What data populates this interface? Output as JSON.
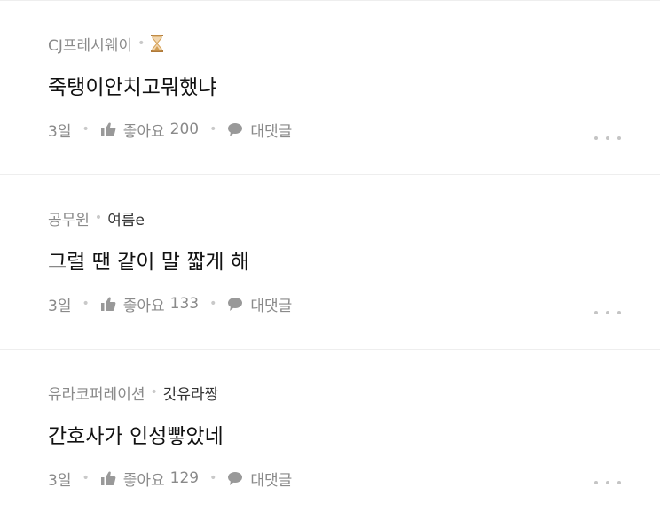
{
  "comments": [
    {
      "company": "CJ프레시웨이",
      "nickname": "",
      "has_hourglass": true,
      "text": "죽탱이안치고뭐했냐",
      "time": "3일",
      "like_label": "좋아요",
      "like_count": "200",
      "reply_label": "대댓글"
    },
    {
      "company": "공무원",
      "nickname": "여름e",
      "has_hourglass": false,
      "text": "그럴 땐 같이 말 짧게 해",
      "time": "3일",
      "like_label": "좋아요",
      "like_count": "133",
      "reply_label": "대댓글"
    },
    {
      "company": "유라코퍼레이션",
      "nickname": "갓유라짱",
      "has_hourglass": false,
      "text": "간호사가 인성빻았네",
      "time": "3일",
      "like_label": "좋아요",
      "like_count": "129",
      "reply_label": "대댓글"
    }
  ],
  "colors": {
    "meta_gray": "#8a8a8a",
    "text_dark": "#111111",
    "hourglass": "#d4a055"
  },
  "icons": {
    "like": "thumbs-up-icon",
    "reply": "speech-bubble-icon",
    "more": "more-dots-icon",
    "badge": "hourglass-icon"
  }
}
